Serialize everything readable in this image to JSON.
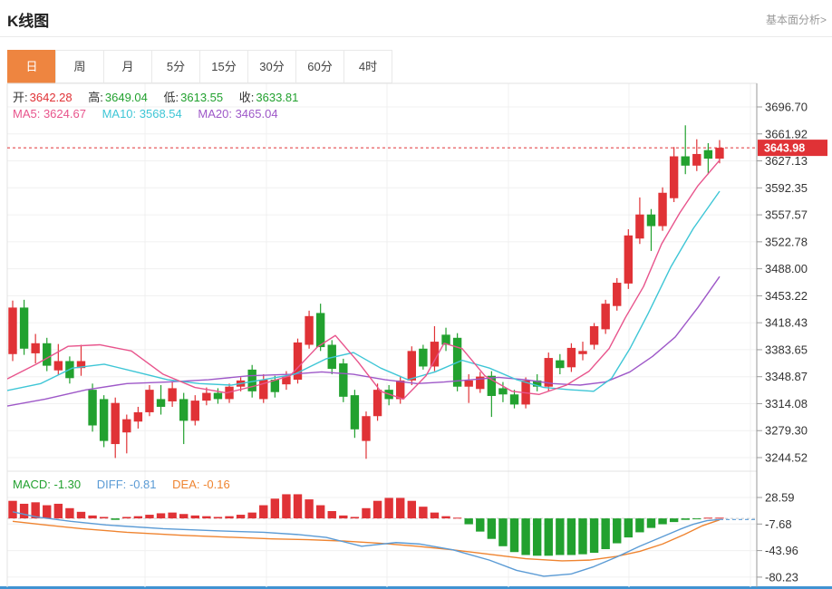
{
  "header": {
    "title": "K线图",
    "link": "基本面分析>"
  },
  "tabs": {
    "items": [
      {
        "label": "日",
        "active": true
      },
      {
        "label": "周",
        "active": false
      },
      {
        "label": "月",
        "active": false
      },
      {
        "label": "5分",
        "active": false
      },
      {
        "label": "15分",
        "active": false
      },
      {
        "label": "30分",
        "active": false
      },
      {
        "label": "60分",
        "active": false
      },
      {
        "label": "4时",
        "active": false
      }
    ]
  },
  "ohlc": {
    "open_label": "开:",
    "open": "3642.28",
    "high_label": "高:",
    "high": "3649.04",
    "low_label": "低:",
    "low": "3613.55",
    "close_label": "收:",
    "close": "3633.81"
  },
  "ma_info": {
    "ma5": "MA5: 3624.67",
    "ma10": "MA10: 3568.54",
    "ma20": "MA20: 3465.04"
  },
  "macd_info": {
    "macd": "MACD: -1.30",
    "diff": "DIFF: -0.81",
    "dea": "DEA: -0.16"
  },
  "price_tag": "3643.98",
  "colors": {
    "up": "#e03236",
    "down": "#22a12f",
    "ma5": "#e8548c",
    "ma10": "#3ec6d6",
    "ma20": "#9e58c8",
    "diff": "#5b9bd5",
    "dea": "#ef8430",
    "tab_accent": "#ee8540",
    "price_line": "#e03236",
    "grid": "#f0f0f0",
    "frame": "#e3e3e3",
    "axis": "#999999"
  },
  "chart_data": {
    "type": "candlestick",
    "panels": [
      "price",
      "macd"
    ],
    "legend": [
      "MA5",
      "MA10",
      "MA20",
      "MACD",
      "DIFF",
      "DEA"
    ],
    "price_axis_labels": [
      "3696.70",
      "3661.92",
      "3627.13",
      "3592.35",
      "3557.57",
      "3522.78",
      "3488.00",
      "3453.22",
      "3418.43",
      "3383.65",
      "3348.87",
      "3314.08",
      "3279.30",
      "3244.52"
    ],
    "macd_axis_labels": [
      "28.59",
      "-7.68",
      "-43.96",
      "-80.23"
    ],
    "current_price": 3643.98,
    "candles": [
      [
        3378,
        3447,
        3369,
        3438
      ],
      [
        3438,
        3448,
        3377,
        3385
      ],
      [
        3379,
        3404,
        3366,
        3392
      ],
      [
        3392,
        3399,
        3356,
        3363
      ],
      [
        3357,
        3391,
        3351,
        3369
      ],
      [
        3369,
        3375,
        3340,
        3347
      ],
      [
        3360,
        3390,
        3350,
        3369
      ],
      [
        3332,
        3340,
        3278,
        3286
      ],
      [
        3320,
        3325,
        3258,
        3266
      ],
      [
        3262,
        3322,
        3244,
        3315
      ],
      [
        3277,
        3300,
        3250,
        3294
      ],
      [
        3291,
        3310,
        3282,
        3303
      ],
      [
        3303,
        3338,
        3298,
        3332
      ],
      [
        3320,
        3338,
        3300,
        3310
      ],
      [
        3317,
        3342,
        3310,
        3334
      ],
      [
        3320,
        3328,
        3262,
        3292
      ],
      [
        3292,
        3325,
        3286,
        3318
      ],
      [
        3318,
        3335,
        3312,
        3328
      ],
      [
        3328,
        3334,
        3314,
        3320
      ],
      [
        3320,
        3340,
        3315,
        3336
      ],
      [
        3336,
        3348,
        3330,
        3344
      ],
      [
        3358,
        3364,
        3322,
        3330
      ],
      [
        3320,
        3352,
        3315,
        3345
      ],
      [
        3345,
        3350,
        3322,
        3329
      ],
      [
        3339,
        3356,
        3332,
        3349
      ],
      [
        3345,
        3398,
        3340,
        3393
      ],
      [
        3390,
        3434,
        3385,
        3427
      ],
      [
        3431,
        3443,
        3382,
        3387
      ],
      [
        3390,
        3396,
        3352,
        3359
      ],
      [
        3366,
        3372,
        3316,
        3323
      ],
      [
        3325,
        3332,
        3270,
        3281
      ],
      [
        3266,
        3304,
        3243,
        3298
      ],
      [
        3298,
        3340,
        3292,
        3332
      ],
      [
        3332,
        3338,
        3312,
        3320
      ],
      [
        3320,
        3350,
        3314,
        3344
      ],
      [
        3344,
        3388,
        3338,
        3382
      ],
      [
        3385,
        3390,
        3358,
        3362
      ],
      [
        3362,
        3414,
        3356,
        3394
      ],
      [
        3403,
        3412,
        3382,
        3390
      ],
      [
        3399,
        3405,
        3330,
        3336
      ],
      [
        3336,
        3352,
        3315,
        3344
      ],
      [
        3333,
        3355,
        3328,
        3349
      ],
      [
        3350,
        3356,
        3297,
        3324
      ],
      [
        3334,
        3342,
        3316,
        3326
      ],
      [
        3326,
        3332,
        3308,
        3313
      ],
      [
        3313,
        3348,
        3308,
        3344
      ],
      [
        3344,
        3352,
        3330,
        3336
      ],
      [
        3336,
        3380,
        3330,
        3373
      ],
      [
        3370,
        3378,
        3352,
        3360
      ],
      [
        3361,
        3392,
        3355,
        3386
      ],
      [
        3378,
        3394,
        3370,
        3382
      ],
      [
        3390,
        3418,
        3384,
        3414
      ],
      [
        3410,
        3448,
        3404,
        3443
      ],
      [
        3440,
        3476,
        3434,
        3470
      ],
      [
        3469,
        3539,
        3462,
        3531
      ],
      [
        3527,
        3580,
        3520,
        3558
      ],
      [
        3558,
        3565,
        3511,
        3543
      ],
      [
        3543,
        3593,
        3537,
        3586
      ],
      [
        3579,
        3645,
        3574,
        3633
      ],
      [
        3633,
        3673,
        3610,
        3621
      ],
      [
        3621,
        3655,
        3614,
        3636
      ],
      [
        3641,
        3650,
        3610,
        3630
      ],
      [
        3630,
        3654,
        3624,
        3644
      ]
    ],
    "ma5_line": [
      [
        8,
        3346
      ],
      [
        40,
        3365
      ],
      [
        75,
        3388
      ],
      [
        110,
        3390
      ],
      [
        145,
        3382
      ],
      [
        180,
        3352
      ],
      [
        215,
        3335
      ],
      [
        250,
        3328
      ],
      [
        285,
        3338
      ],
      [
        320,
        3350
      ],
      [
        350,
        3387
      ],
      [
        370,
        3402
      ],
      [
        395,
        3368
      ],
      [
        420,
        3330
      ],
      [
        445,
        3320
      ],
      [
        470,
        3350
      ],
      [
        490,
        3392
      ],
      [
        510,
        3385
      ],
      [
        535,
        3350
      ],
      [
        565,
        3330
      ],
      [
        595,
        3326
      ],
      [
        625,
        3338
      ],
      [
        650,
        3356
      ],
      [
        672,
        3385
      ],
      [
        690,
        3425
      ],
      [
        710,
        3465
      ],
      [
        730,
        3520
      ],
      [
        750,
        3560
      ],
      [
        770,
        3595
      ],
      [
        794,
        3628
      ]
    ],
    "ma10_line": [
      [
        8,
        3331
      ],
      [
        45,
        3340
      ],
      [
        80,
        3360
      ],
      [
        115,
        3365
      ],
      [
        150,
        3355
      ],
      [
        185,
        3345
      ],
      [
        220,
        3340
      ],
      [
        255,
        3338
      ],
      [
        290,
        3345
      ],
      [
        325,
        3352
      ],
      [
        360,
        3372
      ],
      [
        390,
        3380
      ],
      [
        420,
        3360
      ],
      [
        450,
        3345
      ],
      [
        480,
        3355
      ],
      [
        510,
        3370
      ],
      [
        540,
        3360
      ],
      [
        570,
        3345
      ],
      [
        600,
        3335
      ],
      [
        630,
        3332
      ],
      [
        655,
        3330
      ],
      [
        675,
        3347
      ],
      [
        695,
        3385
      ],
      [
        715,
        3430
      ],
      [
        740,
        3490
      ],
      [
        765,
        3540
      ],
      [
        794,
        3588
      ]
    ],
    "ma20_line": [
      [
        8,
        3311
      ],
      [
        50,
        3320
      ],
      [
        95,
        3332
      ],
      [
        140,
        3340
      ],
      [
        185,
        3342
      ],
      [
        230,
        3345
      ],
      [
        275,
        3350
      ],
      [
        320,
        3352
      ],
      [
        355,
        3355
      ],
      [
        390,
        3352
      ],
      [
        425,
        3345
      ],
      [
        460,
        3340
      ],
      [
        490,
        3342
      ],
      [
        520,
        3345
      ],
      [
        550,
        3348
      ],
      [
        580,
        3345
      ],
      [
        610,
        3340
      ],
      [
        640,
        3338
      ],
      [
        668,
        3342
      ],
      [
        695,
        3355
      ],
      [
        720,
        3375
      ],
      [
        745,
        3400
      ],
      [
        770,
        3438
      ],
      [
        794,
        3478
      ]
    ],
    "macd_hist": [
      24,
      20,
      22,
      18,
      20,
      14,
      9,
      4,
      2,
      -2,
      2,
      3,
      5,
      7,
      8,
      6,
      4,
      3,
      2,
      3,
      5,
      8,
      18,
      27,
      33,
      33,
      26,
      18,
      10,
      4,
      2,
      14,
      24,
      28,
      28,
      24,
      16,
      8,
      3,
      1,
      -8,
      -18,
      -28,
      -38,
      -46,
      -50,
      -51,
      -51,
      -50,
      -50,
      -49,
      -47,
      -42,
      -34,
      -26,
      -19,
      -13,
      -8,
      -5,
      -2,
      -1,
      1,
      1
    ],
    "diff_line": [
      [
        14,
        9
      ],
      [
        40,
        2
      ],
      [
        78,
        -4
      ],
      [
        117,
        -9
      ],
      [
        180,
        -14
      ],
      [
        240,
        -17
      ],
      [
        291,
        -19
      ],
      [
        328,
        -22
      ],
      [
        360,
        -26
      ],
      [
        399,
        -38
      ],
      [
        437,
        -33
      ],
      [
        463,
        -35
      ],
      [
        500,
        -43
      ],
      [
        540,
        -57
      ],
      [
        570,
        -71
      ],
      [
        600,
        -79
      ],
      [
        630,
        -76
      ],
      [
        655,
        -66
      ],
      [
        680,
        -53
      ],
      [
        706,
        -38
      ],
      [
        731,
        -25
      ],
      [
        750,
        -15
      ],
      [
        765,
        -8
      ],
      [
        780,
        -3
      ],
      [
        794,
        -1.5
      ]
    ],
    "dea_line": [
      [
        14,
        -4
      ],
      [
        50,
        -9
      ],
      [
        90,
        -14
      ],
      [
        140,
        -19
      ],
      [
        200,
        -23
      ],
      [
        260,
        -26
      ],
      [
        300,
        -28
      ],
      [
        340,
        -29
      ],
      [
        380,
        -31
      ],
      [
        420,
        -34
      ],
      [
        460,
        -38
      ],
      [
        500,
        -43
      ],
      [
        540,
        -49
      ],
      [
        580,
        -55
      ],
      [
        620,
        -58
      ],
      [
        650,
        -57
      ],
      [
        680,
        -52
      ],
      [
        706,
        -45
      ],
      [
        731,
        -35
      ],
      [
        755,
        -22
      ],
      [
        775,
        -10
      ],
      [
        794,
        -2
      ]
    ]
  }
}
